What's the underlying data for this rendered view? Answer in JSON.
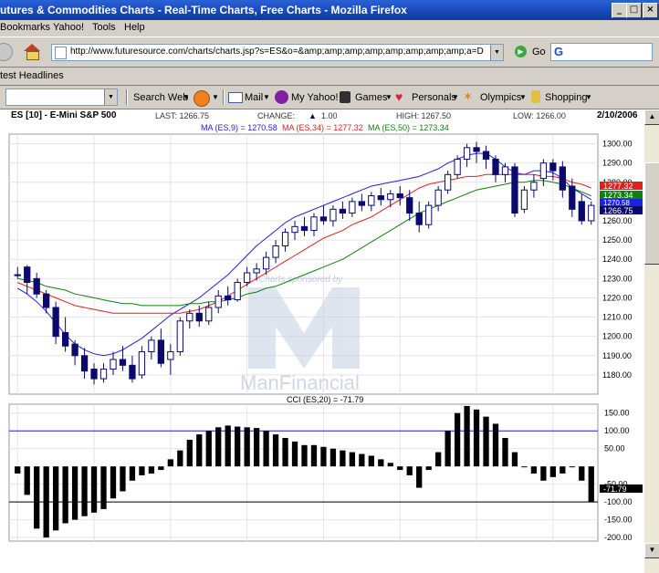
{
  "window": {
    "title": "utures & Commodities Charts - Real-Time Charts, Free Charts - Mozilla Firefox",
    "minimize": "_",
    "maximize": "□",
    "close": "×"
  },
  "menu": [
    "Bookmarks",
    "Yahoo!",
    "Tools",
    "Help"
  ],
  "nav": {
    "url": "http://www.futuresource.com/charts/charts.jsp?s=ES&o=&amp;amp;amp;amp;amp;amp;amp;amp;a=D",
    "go_label": "Go",
    "search_value": "G"
  },
  "headlines_label": "test Headlines",
  "yahoo_toolbar": {
    "search_web": "Search Web",
    "mail": "Mail",
    "my_yahoo": "My Yahoo!",
    "games": "Games",
    "personal": "Personals",
    "olympics": "Olympics",
    "shopping": "Shopping"
  },
  "chart_header": {
    "symbol": "ES [10] - E-Mini S&P 500",
    "last": "LAST: 1266.75",
    "change_label": "CHANGE:",
    "change_value": "1.00",
    "high": "HIGH: 1267.50",
    "low": "LOW: 1266.00",
    "date": "2/10/2006",
    "ma9": "MA (ES,9) = 1270.58",
    "ma34": "MA (ES,34) = 1277.32",
    "ma50": "MA (ES,50) = 1273.34",
    "cci_label": "CCI (ES,20) = -71.79"
  },
  "colors": {
    "ma9": "#2020e0",
    "ma34": "#e02020",
    "ma50": "#108010",
    "candle": "#0a0a6e"
  },
  "watermark": {
    "sponsor": "Charts sponsored by",
    "brand": "ManFinancial"
  },
  "price_labels": {
    "ma34": "1277.32",
    "ma50": "1273.34",
    "ma9": "1270.58",
    "last": "1266.75"
  },
  "cci_value_label": "-71.79",
  "chart_data": [
    {
      "type": "candlestick",
      "title": "ES [10] - E-Mini S&P 500",
      "ylim": [
        1170,
        1305
      ],
      "y_ticks": [
        1180,
        1190,
        1200,
        1210,
        1220,
        1230,
        1240,
        1250,
        1260,
        1270,
        1280,
        1290,
        1300
      ],
      "series": [
        {
          "name": "MA (ES,9)",
          "values": [
            1225,
            1222,
            1218,
            1213,
            1207,
            1201,
            1196,
            1193,
            1191,
            1190,
            1191,
            1193,
            1196,
            1199,
            1203,
            1207,
            1211,
            1214,
            1217,
            1220,
            1224,
            1228,
            1232,
            1237,
            1242,
            1247,
            1251,
            1255,
            1259,
            1262,
            1264,
            1266,
            1268,
            1270,
            1272,
            1274,
            1276,
            1278,
            1279,
            1280,
            1281,
            1282,
            1283,
            1285,
            1287,
            1290,
            1292,
            1294,
            1295,
            1295,
            1292,
            1288,
            1285,
            1284,
            1286,
            1286,
            1285,
            1282,
            1277,
            1274,
            1271
          ]
        },
        {
          "name": "MA (ES,34)",
          "values": [
            1228,
            1226,
            1224,
            1222,
            1220,
            1218,
            1216,
            1215,
            1214,
            1213,
            1212,
            1212,
            1212,
            1212,
            1212,
            1212,
            1212,
            1212,
            1213,
            1214,
            1216,
            1218,
            1221,
            1224,
            1227,
            1230,
            1233,
            1236,
            1239,
            1242,
            1245,
            1248,
            1251,
            1253,
            1255,
            1258,
            1260,
            1262,
            1265,
            1268,
            1271,
            1274,
            1277,
            1279,
            1280,
            1281,
            1282,
            1283,
            1283,
            1284,
            1284,
            1284,
            1284,
            1284,
            1284,
            1283,
            1283,
            1282,
            1280,
            1279,
            1277
          ]
        },
        {
          "name": "MA (ES,50)",
          "values": [
            1230,
            1229,
            1228,
            1226,
            1225,
            1224,
            1222,
            1221,
            1220,
            1219,
            1218,
            1217,
            1217,
            1216,
            1216,
            1216,
            1216,
            1216,
            1217,
            1217,
            1218,
            1218,
            1219,
            1220,
            1222,
            1223,
            1225,
            1226,
            1228,
            1230,
            1232,
            1234,
            1236,
            1238,
            1240,
            1243,
            1246,
            1249,
            1252,
            1255,
            1258,
            1261,
            1264,
            1266,
            1268,
            1270,
            1272,
            1274,
            1276,
            1277,
            1278,
            1279,
            1280,
            1280,
            1281,
            1281,
            1280,
            1279,
            1277,
            1275,
            1273
          ]
        }
      ],
      "candles": [
        [
          1232,
          1236,
          1232,
          1230
        ],
        [
          1236,
          1237,
          1228,
          1222
        ],
        [
          1230,
          1233,
          1222,
          1220
        ],
        [
          1222,
          1224,
          1215,
          1212
        ],
        [
          1215,
          1218,
          1200,
          1196
        ],
        [
          1202,
          1210,
          1195,
          1192
        ],
        [
          1196,
          1198,
          1190,
          1185
        ],
        [
          1190,
          1194,
          1182,
          1178
        ],
        [
          1183,
          1186,
          1178,
          1175
        ],
        [
          1178,
          1186,
          1183,
          1176
        ],
        [
          1183,
          1192,
          1188,
          1180
        ],
        [
          1188,
          1195,
          1185,
          1182
        ],
        [
          1185,
          1190,
          1178,
          1176
        ],
        [
          1180,
          1195,
          1192,
          1178
        ],
        [
          1192,
          1200,
          1198,
          1188
        ],
        [
          1198,
          1204,
          1186,
          1184
        ],
        [
          1188,
          1196,
          1192,
          1180
        ],
        [
          1192,
          1210,
          1208,
          1190
        ],
        [
          1208,
          1214,
          1212,
          1204
        ],
        [
          1212,
          1216,
          1208,
          1205
        ],
        [
          1208,
          1218,
          1215,
          1206
        ],
        [
          1215,
          1224,
          1221,
          1212
        ],
        [
          1221,
          1226,
          1219,
          1216
        ],
        [
          1219,
          1230,
          1228,
          1218
        ],
        [
          1228,
          1236,
          1233,
          1226
        ],
        [
          1233,
          1238,
          1235,
          1229
        ],
        [
          1235,
          1244,
          1241,
          1232
        ],
        [
          1241,
          1250,
          1247,
          1238
        ],
        [
          1247,
          1256,
          1254,
          1244
        ],
        [
          1254,
          1260,
          1257,
          1250
        ],
        [
          1257,
          1262,
          1255,
          1252
        ],
        [
          1255,
          1264,
          1262,
          1252
        ],
        [
          1262,
          1268,
          1260,
          1258
        ],
        [
          1260,
          1268,
          1266,
          1257
        ],
        [
          1266,
          1270,
          1264,
          1261
        ],
        [
          1264,
          1272,
          1270,
          1262
        ],
        [
          1270,
          1274,
          1268,
          1265
        ],
        [
          1268,
          1275,
          1273,
          1265
        ],
        [
          1273,
          1277,
          1271,
          1268
        ],
        [
          1271,
          1276,
          1274,
          1267
        ],
        [
          1274,
          1278,
          1272,
          1268
        ],
        [
          1272,
          1276,
          1264,
          1260
        ],
        [
          1264,
          1270,
          1258,
          1254
        ],
        [
          1258,
          1270,
          1268,
          1256
        ],
        [
          1268,
          1278,
          1276,
          1265
        ],
        [
          1276,
          1286,
          1284,
          1274
        ],
        [
          1284,
          1294,
          1292,
          1282
        ],
        [
          1292,
          1300,
          1298,
          1288
        ],
        [
          1298,
          1301,
          1296,
          1290
        ],
        [
          1296,
          1299,
          1292,
          1287
        ],
        [
          1292,
          1294,
          1284,
          1280
        ],
        [
          1284,
          1290,
          1288,
          1280
        ],
        [
          1288,
          1290,
          1264,
          1262
        ],
        [
          1266,
          1278,
          1276,
          1264
        ],
        [
          1276,
          1284,
          1280,
          1272
        ],
        [
          1282,
          1292,
          1290,
          1278
        ],
        [
          1290,
          1292,
          1286,
          1281
        ],
        [
          1288,
          1291,
          1276,
          1272
        ],
        [
          1278,
          1282,
          1266,
          1262
        ],
        [
          1270,
          1274,
          1260,
          1258
        ],
        [
          1260,
          1270,
          1268,
          1258
        ]
      ]
    },
    {
      "type": "bar",
      "title": "CCI (ES,20) = -71.79",
      "ylim": [
        -210,
        175
      ],
      "y_ticks": [
        150,
        100,
        50,
        -50,
        -100,
        -150,
        -200
      ],
      "reference_lines": [
        100,
        -100
      ],
      "values": [
        -20,
        -80,
        -175,
        -200,
        -180,
        -160,
        -150,
        -140,
        -130,
        -120,
        -90,
        -70,
        -40,
        -25,
        -20,
        -10,
        20,
        45,
        75,
        90,
        100,
        110,
        115,
        112,
        110,
        108,
        100,
        90,
        80,
        70,
        60,
        60,
        55,
        50,
        45,
        40,
        35,
        30,
        20,
        10,
        -10,
        -25,
        -60,
        -10,
        40,
        100,
        150,
        170,
        160,
        140,
        120,
        80,
        40,
        0,
        -20,
        -40,
        -30,
        -20,
        0,
        -40,
        -100
      ]
    }
  ]
}
